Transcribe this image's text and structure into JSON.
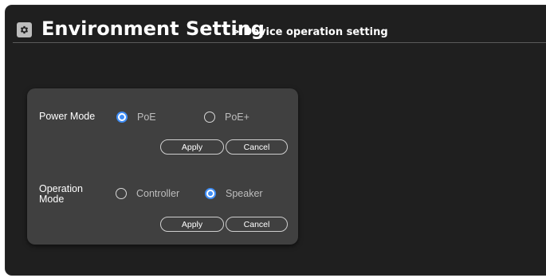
{
  "header": {
    "title": "Environment Setting",
    "breadcrumb": "> Device operation setting",
    "icon": "gear-icon"
  },
  "power_mode": {
    "label": "Power Mode",
    "options": [
      {
        "label": "PoE",
        "selected": true
      },
      {
        "label": "PoE+",
        "selected": false
      }
    ],
    "apply_label": "Apply",
    "cancel_label": "Cancel"
  },
  "operation_mode": {
    "label": "Operation Mode",
    "options": [
      {
        "label": "Controller",
        "selected": false
      },
      {
        "label": "Speaker",
        "selected": true
      }
    ],
    "apply_label": "Apply",
    "cancel_label": "Cancel"
  },
  "colors": {
    "background": "#1f1f1f",
    "panel": "#404040",
    "accent": "#3f8df5"
  }
}
